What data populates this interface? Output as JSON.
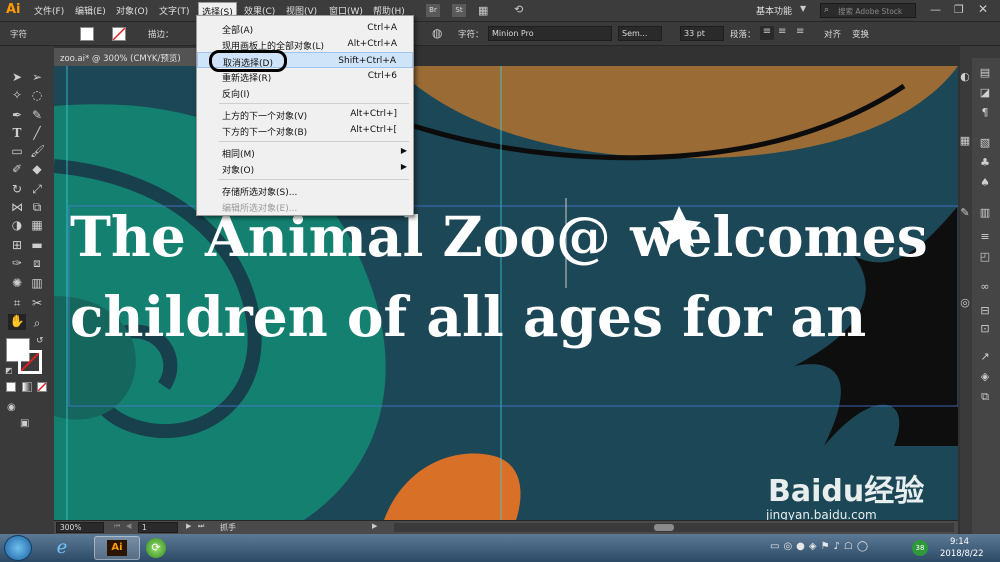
{
  "app": {
    "logo": "Ai",
    "workspace": "基本功能",
    "search_placeholder": "搜索 Adobe Stock"
  },
  "menu": {
    "items": [
      "文件(F)",
      "编辑(E)",
      "对象(O)",
      "文字(T)",
      "选择(S)",
      "效果(C)",
      "视图(V)",
      "窗口(W)",
      "帮助(H)"
    ],
    "br": "Br",
    "st": "St"
  },
  "control_bar": {
    "left_label": "字符",
    "stroke_label": "描边：",
    "char_label": "字符：",
    "font": "Minion Pro",
    "style": "Sem...",
    "size": "33 pt",
    "para_label": "段落：",
    "align_label": "对齐",
    "transform_label": "变换"
  },
  "document": {
    "tab_title": "zoo.ai* @ 300% (CMYK/预览)"
  },
  "dropdown": {
    "items": [
      {
        "label": "全部(A)",
        "shortcut": "Ctrl+A"
      },
      {
        "label": "现用画板上的全部对象(L)",
        "shortcut": "Alt+Ctrl+A"
      },
      {
        "label": "取消选择(D)",
        "shortcut": "Shift+Ctrl+A"
      },
      {
        "label": "重新选择(R)",
        "shortcut": "Ctrl+6"
      },
      {
        "label": "反向(I)",
        "shortcut": ""
      },
      {
        "label": "上方的下一个对象(V)",
        "shortcut": "Alt+Ctrl+]"
      },
      {
        "label": "下方的下一个对象(B)",
        "shortcut": "Alt+Ctrl+["
      },
      {
        "label": "相同(M)",
        "shortcut": ""
      },
      {
        "label": "对象(O)",
        "shortcut": ""
      },
      {
        "label": "存储所选对象(S)...",
        "shortcut": ""
      },
      {
        "label": "编辑所选对象(E)...",
        "shortcut": ""
      }
    ]
  },
  "canvas_text": {
    "line1": "The Animal Zoo@ welcomes",
    "line2": "children of all ages for an"
  },
  "status": {
    "zoom": "300%",
    "page": "1",
    "tool": "抓手"
  },
  "taskbar": {
    "app_label": "Ai",
    "time": "9:14",
    "date": "2018/8/22",
    "badge": "38"
  },
  "watermark": {
    "brand": "Baidu经验",
    "url": "jingyan.baidu.com"
  },
  "colors": {
    "canvas_bg": "#1c4756",
    "teal_shape": "#148070",
    "brown_shape": "#9a6b35",
    "orange_shape": "#d87028",
    "menu_highlight": "#cfe4f8"
  }
}
